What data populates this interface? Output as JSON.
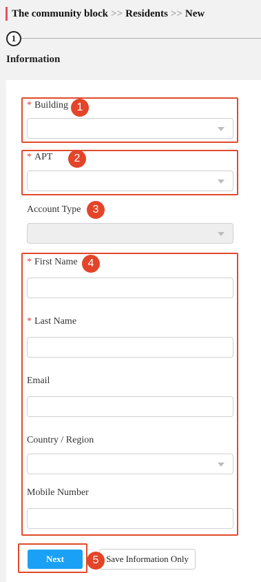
{
  "breadcrumb": {
    "part1": "The community block",
    "sep1": ">>",
    "part2": "Residents",
    "sep2": ">>",
    "part3": "New"
  },
  "step": {
    "number": "1"
  },
  "section_title": "Information",
  "form": {
    "required_mark": "*",
    "building": {
      "label": "Building",
      "value": ""
    },
    "apt": {
      "label": "APT",
      "value": ""
    },
    "account_type": {
      "label": "Account Type",
      "value": ""
    },
    "first_name": {
      "label": "First Name",
      "value": ""
    },
    "last_name": {
      "label": "Last Name",
      "value": ""
    },
    "email": {
      "label": "Email",
      "value": ""
    },
    "country": {
      "label": "Country / Region",
      "value": ""
    },
    "mobile": {
      "label": "Mobile Number",
      "value": ""
    }
  },
  "buttons": {
    "next": "Next",
    "save_only": "Save Information Only"
  },
  "annotations": [
    "1",
    "2",
    "3",
    "4",
    "5"
  ],
  "colors": {
    "accent": "#1aa1f5",
    "annotation": "#e3452a",
    "required": "#e53935",
    "breadcrumb_bar": "#e8505b"
  }
}
